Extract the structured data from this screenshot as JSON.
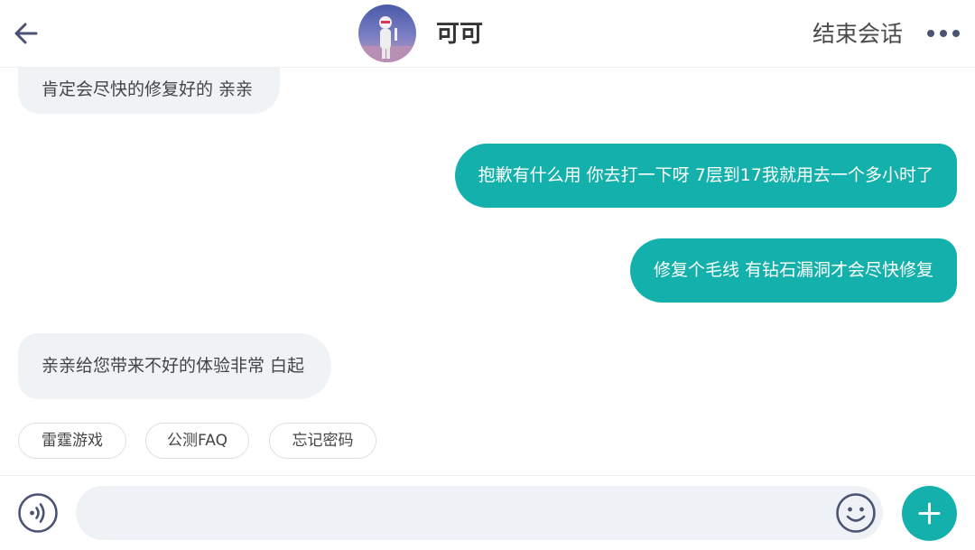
{
  "header": {
    "contact_name": "可可",
    "end_session_label": "结束会话",
    "icons": [
      "back-arrow-icon",
      "avatar",
      "more-dots-icon"
    ]
  },
  "messages": [
    {
      "side": "incoming",
      "text": "肯定会尽快的修复好的 亲亲"
    },
    {
      "side": "outgoing",
      "text": "抱歉有什么用 你去打一下呀 7层到17我就用去一个多小时了"
    },
    {
      "side": "outgoing",
      "text": "修复个毛线 有钻石漏洞才会尽快修复"
    },
    {
      "side": "incoming",
      "text": "亲亲给您带来不好的体验非常 白起"
    }
  ],
  "quick_replies": [
    "雷霆游戏",
    "公测FAQ",
    "忘记密码"
  ],
  "input_bar": {
    "message_value": "",
    "icons": [
      "voice-icon",
      "emoji-icon",
      "plus-icon"
    ]
  },
  "colors": {
    "accent": "#14b1ac",
    "incoming_bubble": "#eff3f6",
    "icon_color": "#4b5373"
  }
}
